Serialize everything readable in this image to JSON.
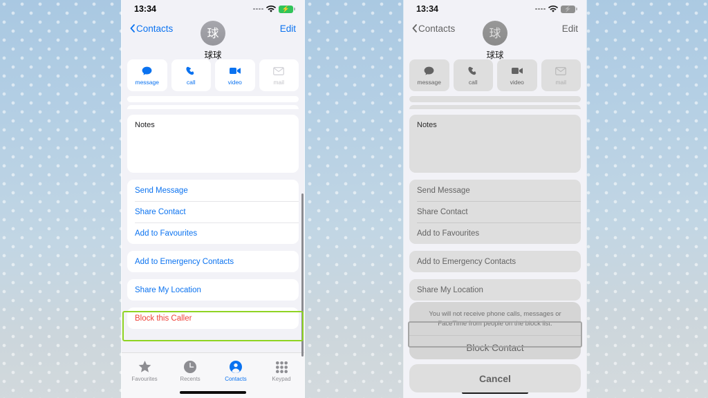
{
  "status_bar": {
    "time": "13:34",
    "signal_icon": "signal-dots-icon",
    "wifi_icon": "wifi-icon",
    "battery_icon": "battery-charging-icon",
    "battery_color": "#31c45a"
  },
  "nav": {
    "back_label": "Contacts",
    "back_icon": "chevron-left-icon",
    "edit_label": "Edit"
  },
  "contact": {
    "avatar_initial": "球",
    "name": "球球"
  },
  "quick_actions": [
    {
      "label": "message",
      "icon": "message-bubble-icon",
      "enabled": true
    },
    {
      "label": "call",
      "icon": "phone-handset-icon",
      "enabled": true
    },
    {
      "label": "video",
      "icon": "video-camera-icon",
      "enabled": true
    },
    {
      "label": "mail",
      "icon": "envelope-icon",
      "enabled": false
    }
  ],
  "notes": {
    "label": "Notes",
    "value": ""
  },
  "option_groups": [
    {
      "rows": [
        {
          "label": "Send Message",
          "style": "link"
        },
        {
          "label": "Share Contact",
          "style": "link"
        },
        {
          "label": "Add to Favourites",
          "style": "link"
        }
      ]
    },
    {
      "rows": [
        {
          "label": "Add to Emergency Contacts",
          "style": "link"
        }
      ]
    },
    {
      "rows": [
        {
          "label": "Share My Location",
          "style": "link"
        }
      ]
    },
    {
      "rows": [
        {
          "label": "Block this Caller",
          "style": "danger"
        }
      ]
    }
  ],
  "tab_bar": [
    {
      "label": "Favourites",
      "icon": "star-icon",
      "active": false
    },
    {
      "label": "Recents",
      "icon": "clock-icon",
      "active": false
    },
    {
      "label": "Contacts",
      "icon": "person-circle-icon",
      "active": true
    },
    {
      "label": "Keypad",
      "icon": "keypad-dots-icon",
      "active": false
    }
  ],
  "action_sheet": {
    "message": "You will not receive phone calls, messages or FaceTime from people on the block list.",
    "confirm_label": "Block Contact",
    "cancel_label": "Cancel"
  },
  "annotation": {
    "highlight_color": "#8fd422",
    "left_target": "Block this Caller",
    "right_target": "Block Contact"
  }
}
